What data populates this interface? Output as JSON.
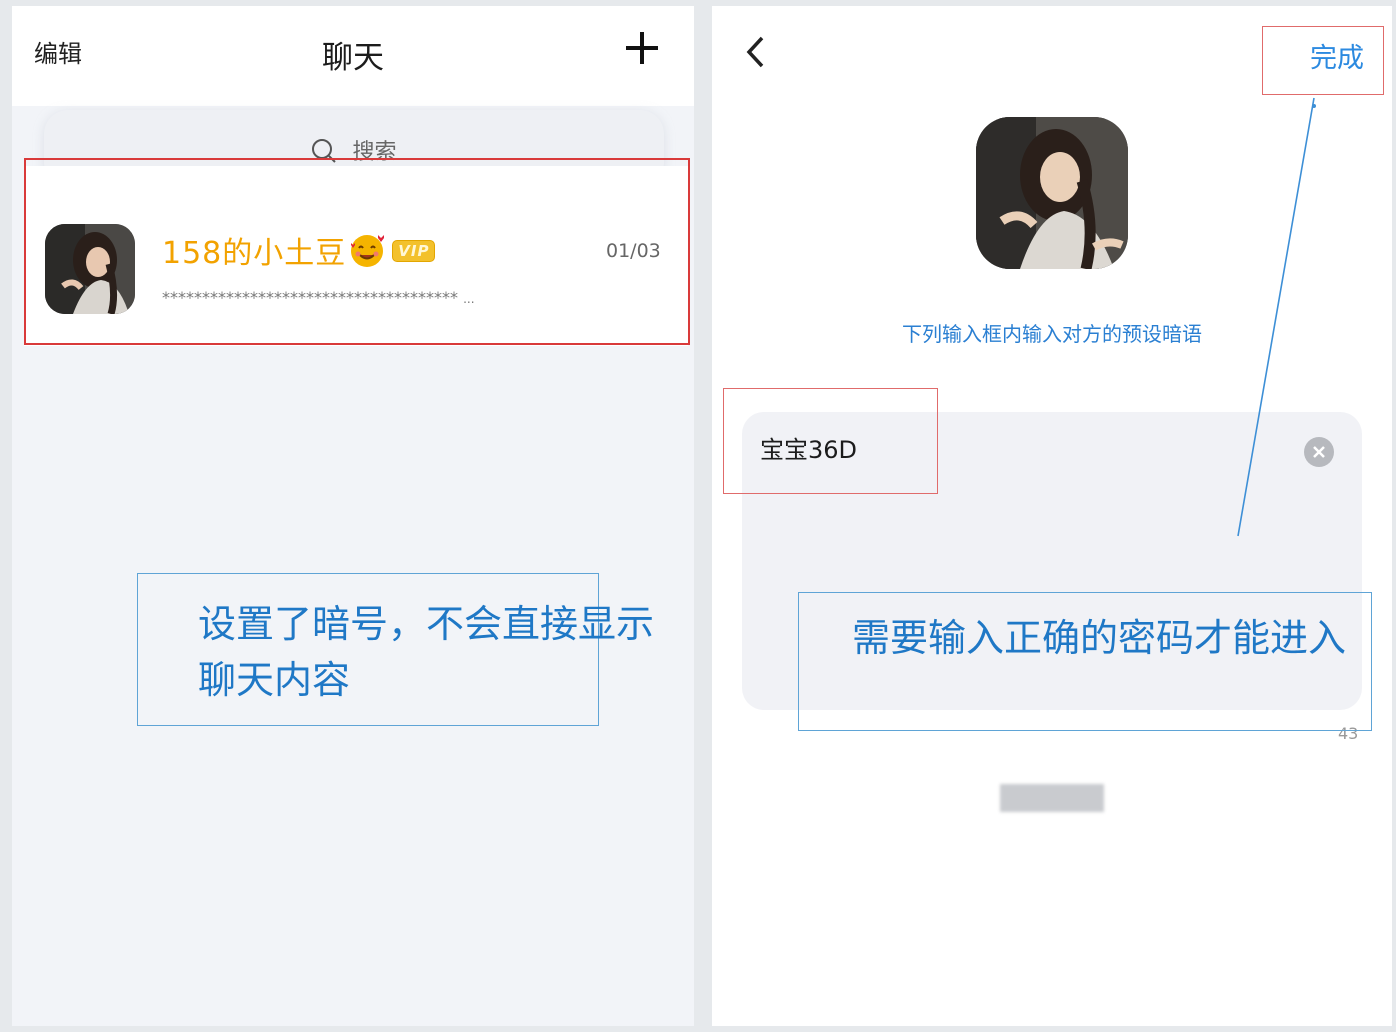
{
  "left": {
    "header": {
      "edit_label": "编辑",
      "title": "聊天",
      "add_icon": "plus-icon"
    },
    "search": {
      "placeholder": "搜索",
      "icon": "search-icon"
    },
    "chat": {
      "name": "158的小土豆",
      "badge": "VIP",
      "date": "01/03",
      "preview": "*************************************",
      "ellipsis": "..."
    },
    "annotation": {
      "line1": "设置了暗号，不会直接显示",
      "line2": "聊天内容"
    }
  },
  "right": {
    "header": {
      "back_icon": "chevron-left-icon",
      "done_label": "完成"
    },
    "hint": "下列输入框内输入对方的预设暗语",
    "input": {
      "value": "宝宝36D",
      "counter": "43"
    },
    "annotation": "需要输入正确的密码才能进入"
  },
  "colors": {
    "annotation_box": "#d93a3a",
    "annotation_text": "#1f78c6",
    "accent": "#2c8ae0",
    "name": "#f2a200"
  }
}
